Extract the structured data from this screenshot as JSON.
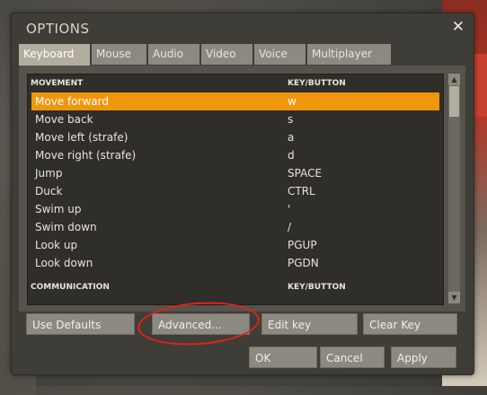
{
  "dialog": {
    "title": "OPTIONS",
    "close_glyph": "✕"
  },
  "tabs": [
    {
      "label": "Keyboard",
      "active": true
    },
    {
      "label": "Mouse",
      "active": false
    },
    {
      "label": "Audio",
      "active": false
    },
    {
      "label": "Video",
      "active": false
    },
    {
      "label": "Voice",
      "active": false
    },
    {
      "label": "Multiplayer",
      "active": false
    }
  ],
  "list": {
    "header": {
      "col1": "MOVEMENT",
      "col2": "KEY/BUTTON"
    },
    "rows": [
      {
        "action": "Move forward",
        "key": "w",
        "selected": true
      },
      {
        "action": "Move back",
        "key": "s"
      },
      {
        "action": "Move left (strafe)",
        "key": "a"
      },
      {
        "action": "Move right (strafe)",
        "key": "d"
      },
      {
        "action": "Jump",
        "key": "SPACE"
      },
      {
        "action": "Duck",
        "key": "CTRL"
      },
      {
        "action": "Swim up",
        "key": "'"
      },
      {
        "action": "Swim down",
        "key": "/"
      },
      {
        "action": "Look up",
        "key": "PGUP"
      },
      {
        "action": "Look down",
        "key": "PGDN"
      }
    ],
    "header2": {
      "col1": "COMMUNICATION",
      "col2": "KEY/BUTTON"
    }
  },
  "buttons": {
    "use_defaults": "Use Defaults",
    "advanced": "Advanced...",
    "edit_key": "Edit key",
    "clear_key": "Clear Key",
    "ok": "OK",
    "cancel": "Cancel",
    "apply": "Apply"
  },
  "colors": {
    "selection": "#f0960c",
    "annotation_circle": "#e12318"
  }
}
